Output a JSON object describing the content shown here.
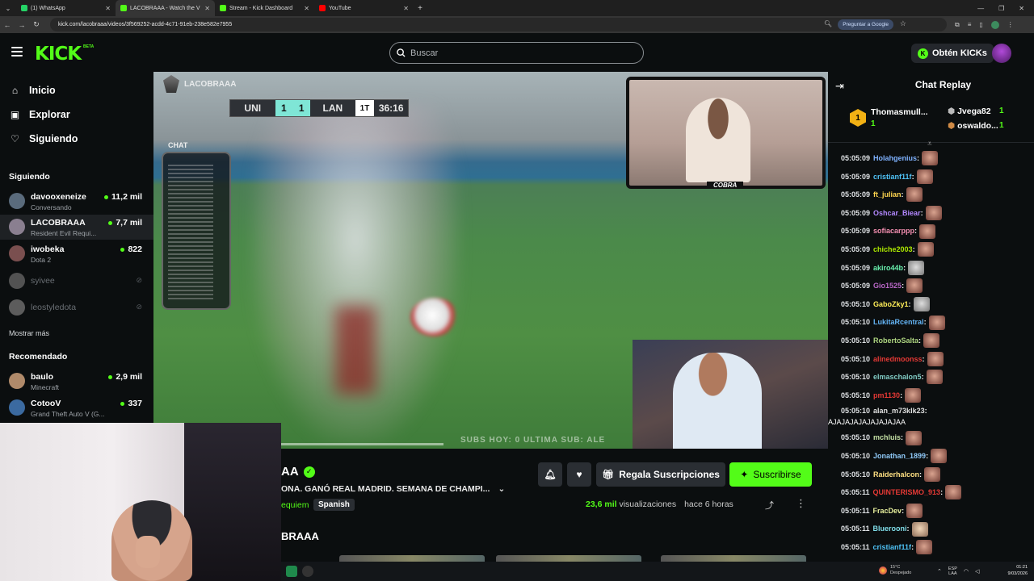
{
  "browser": {
    "tabs": [
      {
        "title": "(1) WhatsApp",
        "color": "#25d366"
      },
      {
        "title": "LACOBRAAA - Watch the V",
        "color": "#53fc18",
        "active": true
      },
      {
        "title": "Stream - Kick Dashboard",
        "color": "#53fc18"
      },
      {
        "title": "YouTube",
        "color": "#ff0000"
      }
    ],
    "url": "kick.com/lacobraaa/videos/3f569252-acdd-4c71-91eb-238e582e7955",
    "google_button": "Preguntar a Google"
  },
  "header": {
    "logo": "KICK",
    "logo_badge": "BETA",
    "search_placeholder": "Buscar",
    "get_kicks": "Obtén KICKs"
  },
  "sidebar": {
    "nav": [
      {
        "label": "Inicio",
        "icon": "home-icon"
      },
      {
        "label": "Explorar",
        "icon": "explore-icon"
      },
      {
        "label": "Siguiendo",
        "icon": "heart-icon"
      }
    ],
    "following_title": "Siguiendo",
    "following": [
      {
        "name": "davooxeneize",
        "category": "Conversando",
        "viewers": "11,2 mil",
        "color": "#5a6b7c"
      },
      {
        "name": "LACOBRAAA",
        "category": "Resident Evil Requi...",
        "viewers": "7,7 mil",
        "color": "#8a7f90"
      },
      {
        "name": "iwobeka",
        "category": "Dota 2",
        "viewers": "822",
        "color": "#7a4f4f"
      },
      {
        "name": "syivee",
        "offline": true,
        "color": "#888"
      },
      {
        "name": "leostyledota",
        "offline": true,
        "color": "#999"
      }
    ],
    "show_more": "Mostrar más",
    "recommended_title": "Recomendado",
    "recommended": [
      {
        "name": "baulo",
        "category": "Minecraft",
        "viewers": "2,9 mil",
        "color": "#b08a6a"
      },
      {
        "name": "CotooV",
        "category": "Grand Theft Auto V (G...",
        "viewers": "337",
        "color": "#3b6aa0"
      }
    ]
  },
  "video": {
    "streamer_tag": "LACOBRAAA",
    "scoreboard": {
      "home": "UNI",
      "home_score": "1",
      "away_score": "1",
      "away": "LAN",
      "half": "1T",
      "time": "36:16"
    },
    "chat_overlay_label": "CHAT",
    "webcam_label": "COBRA",
    "ticker": "SUBS HOY: 0      ULTIMA SUB:    ALE",
    "progress": 0.43
  },
  "info": {
    "channel": "AA",
    "title": "ONA. GANÓ REAL MADRID. SEMANA DE CHAMPI...",
    "category": "equiem",
    "language": "Spanish",
    "gift_subs": "Regala Suscripciones",
    "subscribe": "Suscribirse",
    "views_count": "23,6 mil",
    "views_label": "visualizaciones",
    "time_ago": "hace 6 horas",
    "channel_heading": "BRAAA"
  },
  "chat": {
    "title": "Chat Replay",
    "leaderboard": {
      "first": {
        "name": "Thomasmull...",
        "count": "1",
        "rank": "1"
      },
      "second": {
        "name": "Jvega82",
        "count": "1"
      },
      "third": {
        "name": "oswaldo...",
        "count": "1"
      }
    },
    "messages": [
      {
        "ts": "05:05:09",
        "user": "Holahgenius",
        "color": "#7fb2ff",
        "emote": "emote"
      },
      {
        "ts": "05:05:09",
        "user": "cristianf11f",
        "color": "#4fc3f7",
        "emote": "emote"
      },
      {
        "ts": "05:05:09",
        "user": "ft_julian",
        "color": "#ffd54f",
        "emote": "emote"
      },
      {
        "ts": "05:05:09",
        "user": "Oshcar_Biear",
        "color": "#b388ff",
        "emote": "emote"
      },
      {
        "ts": "05:05:09",
        "user": "sofiacarppp",
        "color": "#f48fb1",
        "emote": "emote"
      },
      {
        "ts": "05:05:09",
        "user": "chiche2003",
        "color": "#aeea00",
        "emote": "emote"
      },
      {
        "ts": "05:05:09",
        "user": "akiro44b",
        "color": "#69f0ae",
        "emote": "cat"
      },
      {
        "ts": "05:05:09",
        "user": "Gio1525",
        "color": "#ba68c8",
        "emote": "emote"
      },
      {
        "ts": "05:05:10",
        "user": "GaboZky1",
        "color": "#ffee58",
        "emote": "cat"
      },
      {
        "ts": "05:05:10",
        "user": "LukitaRcentral",
        "color": "#64b5f6",
        "emote": "emote"
      },
      {
        "ts": "05:05:10",
        "user": "RobertoSalta",
        "color": "#aed581",
        "emote": "emote"
      },
      {
        "ts": "05:05:10",
        "user": "alinedmoonss",
        "color": "#e53935",
        "emote": "emote"
      },
      {
        "ts": "05:05:10",
        "user": "elmaschalon5",
        "color": "#80cbc4",
        "emote": "emote"
      },
      {
        "ts": "05:05:10",
        "user": "pm1130",
        "color": "#e53935",
        "emote": "emote"
      },
      {
        "ts": "05:05:10",
        "user": "alan_m73klk23",
        "color": "#e0e0e0",
        "text": "AJAJAJAJAJAJAJAJAA"
      },
      {
        "ts": "05:05:10",
        "user": "mchluis",
        "color": "#c5e1a5",
        "emote": "emote"
      },
      {
        "ts": "05:05:10",
        "user": "Jonathan_1899",
        "color": "#90caf9",
        "emote": "emote"
      },
      {
        "ts": "05:05:10",
        "user": "Raiderhalcon",
        "color": "#ffe082",
        "emote": "emote"
      },
      {
        "ts": "05:05:11",
        "user": "QUINTERISMO_913",
        "color": "#e53935",
        "emote": "emote"
      },
      {
        "ts": "05:05:11",
        "user": "FracDev",
        "color": "#e6ee9c",
        "emote": "emote"
      },
      {
        "ts": "05:05:11",
        "user": "Bluerooni",
        "color": "#80deea",
        "emote": "face"
      },
      {
        "ts": "05:05:11",
        "user": "cristianf11f",
        "color": "#4fc3f7",
        "emote": "emote"
      }
    ]
  },
  "taskbar": {
    "temp": "15°C",
    "weather": "Despejado",
    "lang_top": "ESP",
    "lang_bottom": "LAA",
    "time": "01:21",
    "date": "9/03/2026"
  }
}
